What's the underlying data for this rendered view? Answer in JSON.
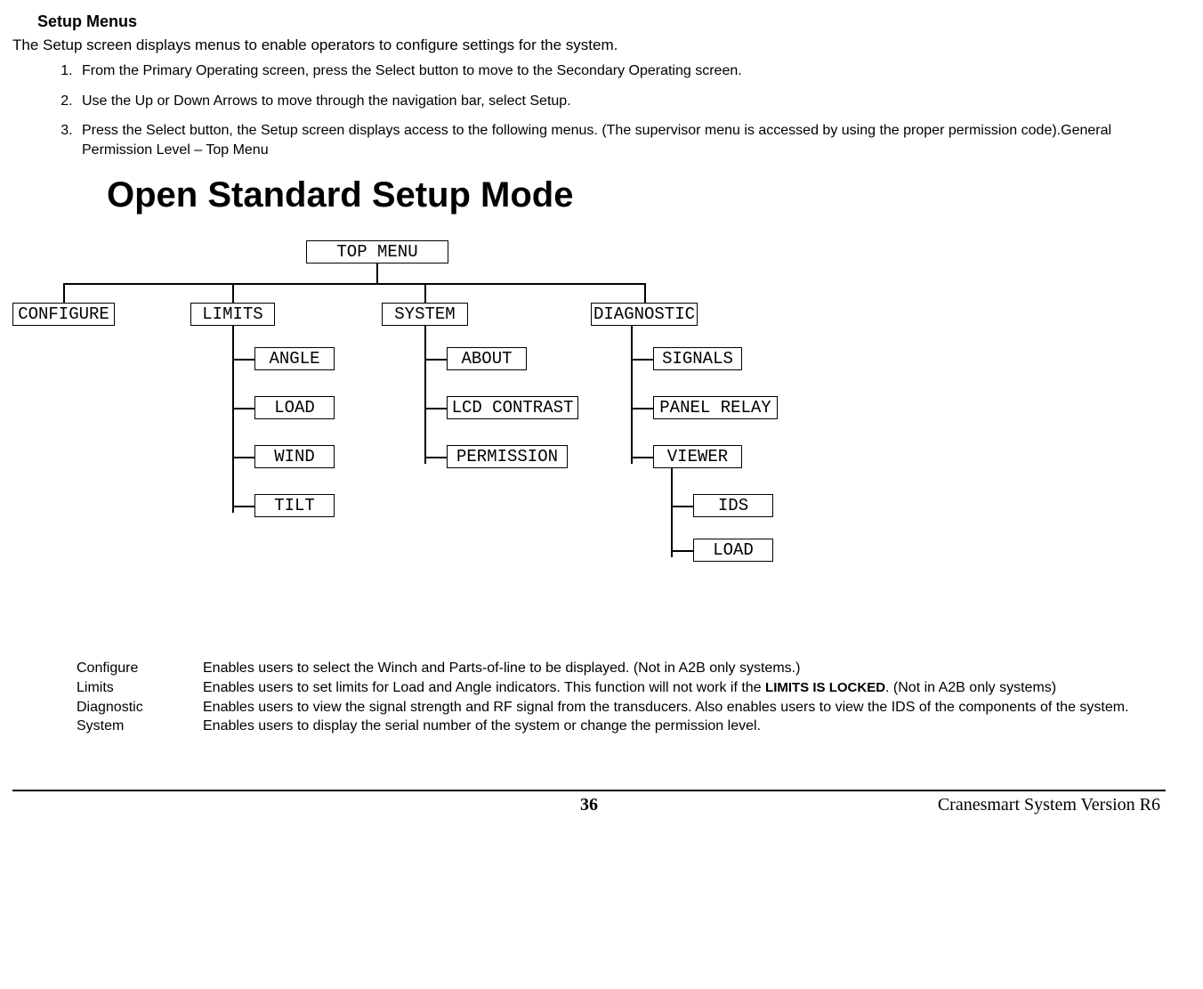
{
  "heading": "Setup Menus",
  "intro": "The Setup screen displays menus to enable operators to configure settings for the system.",
  "steps": [
    "From the Primary Operating screen, press the Select button to move to the Secondary Operating screen.",
    "Use the Up or Down Arrows to move through the navigation bar, select Setup.",
    "Press the Select button, the Setup screen displays access to the following menus. (The supervisor menu is accessed by using the proper permission code).General Permission Level – Top Menu"
  ],
  "mode_heading": "Open Standard Setup Mode",
  "diagram": {
    "top_menu": "TOP MENU",
    "configure": "CONFIGURE",
    "limits": {
      "label": "LIMITS",
      "items": [
        "ANGLE",
        "LOAD",
        "WIND",
        "TILT"
      ]
    },
    "system": {
      "label": "SYSTEM",
      "items": [
        "ABOUT",
        "LCD CONTRAST",
        "PERMISSION"
      ]
    },
    "diagnostic": {
      "label": "DIAGNOSTIC",
      "items": [
        "SIGNALS",
        "PANEL RELAY",
        "VIEWER"
      ],
      "viewer_items": [
        "IDS",
        "LOAD"
      ]
    }
  },
  "defs": {
    "configure": {
      "term": "Configure",
      "desc": "Enables users to select the Winch and Parts-of-line to be displayed. (Not in A2B only systems.)"
    },
    "limits": {
      "term": "Limits",
      "desc_pre": "Enables users to set limits for Load and Angle indicators.  This function will not work if the ",
      "desc_bold": "LIMITS IS LOCKED",
      "desc_post": ". (Not in A2B only systems)"
    },
    "diagnostic": {
      "term": "Diagnostic",
      "desc": "Enables users to view the signal strength and RF signal from the transducers.  Also enables users to view the IDS of the components of the system."
    },
    "system": {
      "term": "System",
      "desc": "Enables users to display the serial number of the system or change the permission level."
    }
  },
  "footer": {
    "page": "36",
    "right": "Cranesmart System Version R6"
  }
}
